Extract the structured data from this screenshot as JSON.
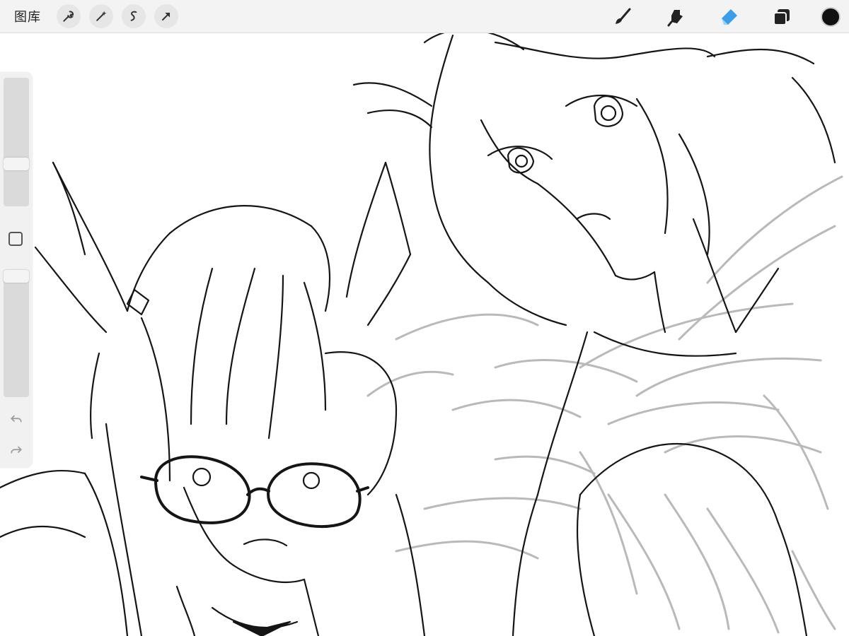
{
  "toolbar": {
    "gallery_label": "图库",
    "left_tools": [
      "wrench-icon",
      "magic-wand-icon",
      "selection-icon",
      "transform-arrow-icon"
    ],
    "right_tools": [
      "brush-icon",
      "smudge-icon",
      "eraser-icon",
      "layers-icon"
    ],
    "color": "#111111",
    "eraser_active_color": "#3a9fe8"
  },
  "sidebar": {
    "brush_size": 0.65,
    "opacity": 0.0,
    "buttons": [
      "modify-square-icon",
      "undo-icon",
      "redo-icon"
    ]
  }
}
